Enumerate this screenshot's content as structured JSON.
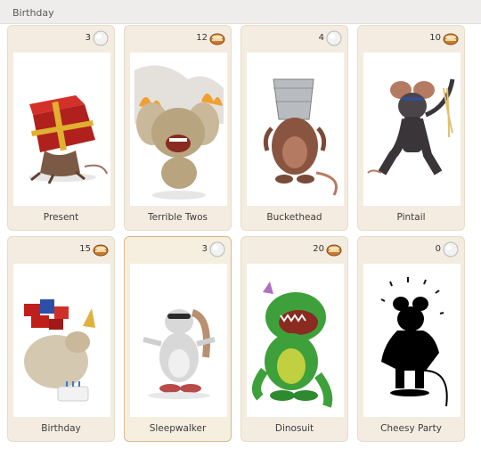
{
  "header": {
    "title": "Birthday"
  },
  "cards": [
    {
      "name": "Present",
      "count": "3",
      "badge": "silver-orb-icon",
      "art": "present-mouse"
    },
    {
      "name": "Terrible Twos",
      "count": "12",
      "badge": "cheese-bowl-icon",
      "art": "terrible-twos-mouse"
    },
    {
      "name": "Buckethead",
      "count": "4",
      "badge": "silver-orb-icon",
      "art": "buckethead-mouse"
    },
    {
      "name": "Pintail",
      "count": "10",
      "badge": "cheese-bowl-icon",
      "art": "pintail-mouse"
    },
    {
      "name": "Birthday",
      "count": "15",
      "badge": "cheese-bowl-icon",
      "art": "birthday-mouse"
    },
    {
      "name": "Sleepwalker",
      "count": "3",
      "badge": "silver-orb-icon",
      "art": "sleepwalker-mouse"
    },
    {
      "name": "Dinosuit",
      "count": "20",
      "badge": "cheese-bowl-icon",
      "art": "dinosuit-mouse"
    },
    {
      "name": "Cheesy Party",
      "count": "0",
      "badge": "silver-orb-icon",
      "art": "cheesy-party-silhouette"
    }
  ],
  "selected_card": "Sleepwalker",
  "colors": {
    "card_bg": "#f4ece0",
    "card_border": "#e6dccb",
    "selected_border": "#d7b98f",
    "header_bg": "#eeedeb"
  }
}
